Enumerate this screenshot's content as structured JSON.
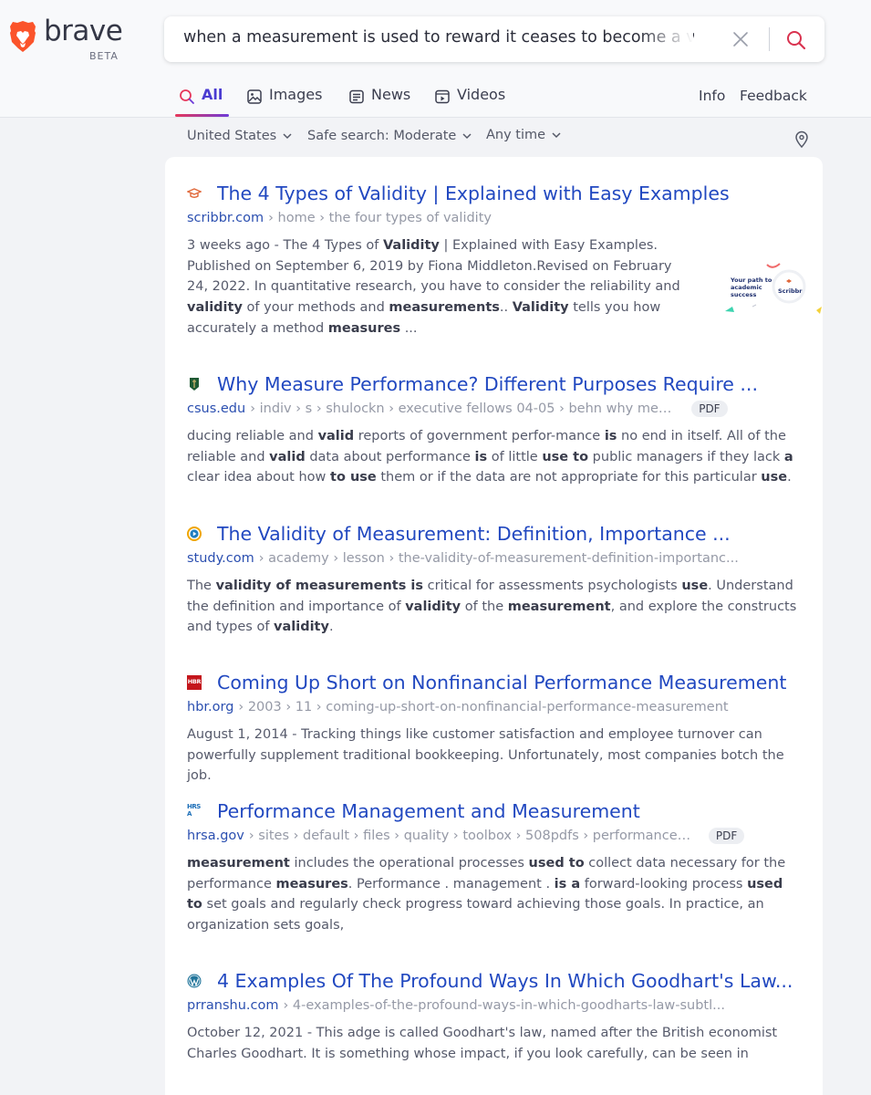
{
  "app": {
    "logo_word": "brave",
    "logo_beta": "BETA"
  },
  "search": {
    "query": "when a measurement is used to reward it ceases to become a valid"
  },
  "tabs": [
    {
      "label": "All",
      "icon": "search-icon",
      "active": true
    },
    {
      "label": "Images",
      "icon": "image-icon",
      "active": false
    },
    {
      "label": "News",
      "icon": "news-icon",
      "active": false
    },
    {
      "label": "Videos",
      "icon": "video-icon",
      "active": false
    }
  ],
  "header_links": {
    "info": "Info",
    "feedback": "Feedback"
  },
  "filters": {
    "region": "United States",
    "safe_search": "Safe search: Moderate",
    "time": "Any time"
  },
  "colors": {
    "accent": "#4a3bd1",
    "title_link": "#2148c0",
    "brave_orange": "#fb542b"
  },
  "results": [
    {
      "title": "The 4 Types of Validity | Explained with Easy Examples",
      "domain": "scribbr.com",
      "path": "› home › the four types of validity",
      "pdf": false,
      "favicon": "graduation-cap-icon",
      "thumbnail_text": "Your path to academic success",
      "thumbnail_brand": "Scribbr",
      "snippet": [
        {
          "t": "3 weeks ago - The 4 Types of "
        },
        {
          "t": "Validity",
          "b": true
        },
        {
          "t": " | Explained with Easy Examples. Published on September 6, 2019 by Fiona Middleton.Revised on February 24, 2022. In quantitative research, you have to consider the reliability and "
        },
        {
          "t": "validity",
          "b": true
        },
        {
          "t": " of your methods and "
        },
        {
          "t": "measurements",
          "b": true
        },
        {
          "t": ".. "
        },
        {
          "t": "Validity",
          "b": true
        },
        {
          "t": " tells you how accurately a method "
        },
        {
          "t": "measures",
          "b": true
        },
        {
          "t": " ..."
        }
      ]
    },
    {
      "title": "Why Measure Performance? Different Purposes Require ...",
      "domain": "csus.edu",
      "path": "› indiv › s › shulockn › executive fellows 04-05 › behn why measure p...",
      "pdf": true,
      "pdf_label": "PDF",
      "favicon": "csus-shield-icon",
      "snippet": [
        {
          "t": "ducing reliable and "
        },
        {
          "t": "valid",
          "b": true
        },
        {
          "t": " reports of government perfor-mance "
        },
        {
          "t": "is",
          "b": true
        },
        {
          "t": " no end in itself. All of the reliable and "
        },
        {
          "t": "valid",
          "b": true
        },
        {
          "t": " data about performance "
        },
        {
          "t": "is",
          "b": true
        },
        {
          "t": " of little "
        },
        {
          "t": "use to",
          "b": true
        },
        {
          "t": " public managers if they lack "
        },
        {
          "t": "a",
          "b": true
        },
        {
          "t": " clear idea about how "
        },
        {
          "t": "to use",
          "b": true
        },
        {
          "t": " them or if the data are not appropriate for this particular "
        },
        {
          "t": "use",
          "b": true
        },
        {
          "t": "."
        }
      ]
    },
    {
      "title": "The Validity of Measurement: Definition, Importance ...",
      "domain": "study.com",
      "path": "› academy › lesson › the-validity-of-measurement-definition-importanc...",
      "pdf": false,
      "favicon": "study-play-icon",
      "snippet": [
        {
          "t": "The "
        },
        {
          "t": "validity of measurements is",
          "b": true
        },
        {
          "t": " critical for assessments psychologists "
        },
        {
          "t": "use",
          "b": true
        },
        {
          "t": ". Understand the definition and importance of "
        },
        {
          "t": "validity",
          "b": true
        },
        {
          "t": " of the "
        },
        {
          "t": "measurement",
          "b": true
        },
        {
          "t": ", and explore the constructs and types of "
        },
        {
          "t": "validity",
          "b": true
        },
        {
          "t": "."
        }
      ]
    },
    {
      "title": "Coming Up Short on Nonfinancial Performance Measurement",
      "domain": "hbr.org",
      "path": "› 2003 › 11 › coming-up-short-on-nonfinancial-performance-measurement",
      "pdf": false,
      "favicon": "hbr-icon",
      "favicon_text": "HBR",
      "snippet": [
        {
          "t": "August 1, 2014 - Tracking things like customer satisfaction and employee turnover can powerfully supplement traditional bookkeeping. Unfortunately, most companies botch the job."
        }
      ]
    },
    {
      "title": "Performance Management and Measurement",
      "domain": "hrsa.gov",
      "path": "› sites › default › files › quality › toolbox › 508pdfs › performancemana...",
      "pdf": true,
      "pdf_label": "PDF",
      "favicon": "hrsa-icon",
      "favicon_text": "HRSA",
      "snippet": [
        {
          "t": "measurement",
          "b": true
        },
        {
          "t": " includes the operational processes "
        },
        {
          "t": "used to",
          "b": true
        },
        {
          "t": " collect data necessary for the performance "
        },
        {
          "t": "measures",
          "b": true
        },
        {
          "t": ". Performance . management . "
        },
        {
          "t": "is a",
          "b": true
        },
        {
          "t": " forward-looking process "
        },
        {
          "t": "used to",
          "b": true
        },
        {
          "t": " set goals and regularly check progress toward achieving those goals. In practice, an organization sets goals,"
        }
      ]
    },
    {
      "title": "4 Examples Of The Profound Ways In Which Goodhart's Law...",
      "domain": "prranshu.com",
      "path": "› 4-examples-of-the-profound-ways-in-which-goodharts-law-subtl...",
      "pdf": false,
      "favicon": "wordpress-icon",
      "snippet": [
        {
          "t": "October 12, 2021 - This adge is called Goodhart's law, named after the British economist Charles Goodhart. It is something whose impact, if you look carefully, can be seen in"
        }
      ]
    }
  ]
}
